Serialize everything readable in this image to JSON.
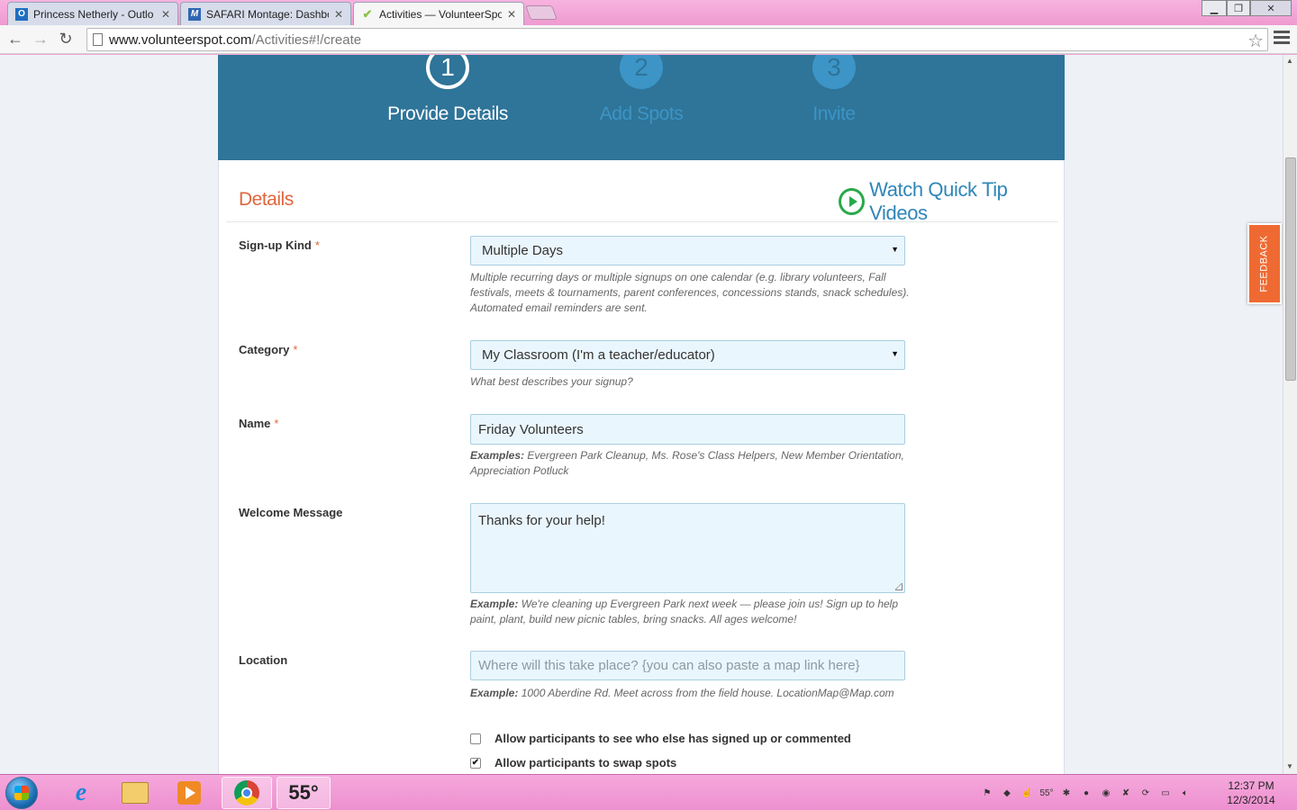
{
  "browser": {
    "tabs": [
      {
        "title": "Princess Netherly - Outlo",
        "icon": "outlook-icon",
        "active": false
      },
      {
        "title": "SAFARI Montage: Dashbo",
        "icon": "safari-montage-icon",
        "active": false
      },
      {
        "title": "Activities — VolunteerSpo",
        "icon": "volunteerspot-icon",
        "active": true
      }
    ],
    "url_host": "www.volunteerspot.com",
    "url_path": "/Activities#!/create"
  },
  "steps": [
    {
      "number": "1",
      "label": "Provide Details",
      "active": true
    },
    {
      "number": "2",
      "label": "Add Spots",
      "active": false
    },
    {
      "number": "3",
      "label": "Invite",
      "active": false
    }
  ],
  "form": {
    "section_title": "Details",
    "quick_tip_label": "Watch Quick Tip Videos",
    "signup_kind": {
      "label": "Sign-up Kind",
      "required_mark": "*",
      "value": "Multiple Days",
      "hint": "Multiple recurring days or multiple signups on one calendar (e.g. library volunteers, Fall festivals, meets & tournaments, parent conferences, concessions stands, snack schedules). Automated email reminders are sent."
    },
    "category": {
      "label": "Category",
      "required_mark": "*",
      "value": "My Classroom (I'm a teacher/educator)",
      "hint": "What best describes your signup?"
    },
    "name": {
      "label": "Name",
      "required_mark": "*",
      "value": "Friday Volunteers",
      "hint_prefix": "Examples:",
      "hint": "Evergreen Park Cleanup, Ms. Rose's Class Helpers, New Member Orientation, Appreciation Potluck"
    },
    "welcome": {
      "label": "Welcome Message",
      "value": "Thanks for your help!",
      "hint_prefix": "Example:",
      "hint": "We're cleaning up Evergreen Park next week — please join us! Sign up to help paint, plant, build new picnic tables, bring snacks. All ages welcome!"
    },
    "location": {
      "label": "Location",
      "placeholder": "Where will this take place? {you can also paste a map link here}",
      "hint_prefix": "Example:",
      "hint": "1000 Aberdine Rd. Meet across from the field house. LocationMap@Map.com"
    },
    "options": [
      {
        "label": "Allow participants to see who else has signed up or commented",
        "checked": false
      },
      {
        "label": "Allow participants to swap spots",
        "checked": true
      }
    ]
  },
  "feedback_label": "FEEDBACK",
  "taskbar": {
    "weather": "55°",
    "tray_temp": "55°",
    "time": "12:37 PM",
    "date": "12/3/2014"
  }
}
